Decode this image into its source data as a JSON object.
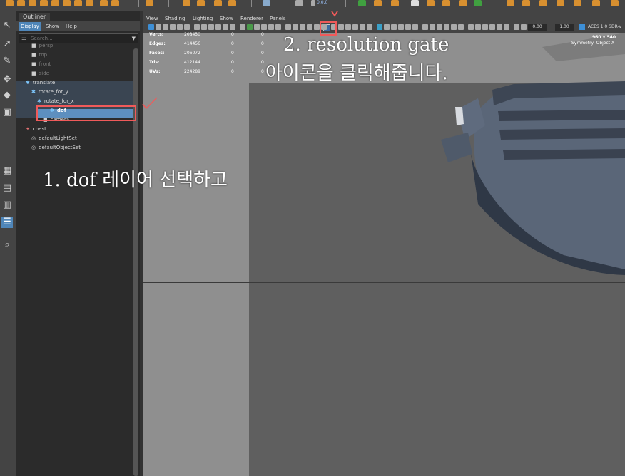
{
  "outliner": {
    "tab_label": "Outliner",
    "menu": [
      "Display",
      "Show",
      "Help"
    ],
    "search_placeholder": "Search...",
    "rows": [
      {
        "label": "persp",
        "icon": "camera-icon",
        "dim": true
      },
      {
        "label": "top",
        "icon": "camera-icon",
        "dim": true
      },
      {
        "label": "front",
        "icon": "camera-icon",
        "dim": true
      },
      {
        "label": "side",
        "icon": "camera-icon",
        "dim": true
      },
      {
        "label": "translate",
        "icon": "transform-icon"
      },
      {
        "label": "rotate_for_y",
        "icon": "transform-icon"
      },
      {
        "label": "rotate_for_x",
        "icon": "transform-icon"
      },
      {
        "label": "dof",
        "icon": "transform-icon",
        "selected": true
      },
      {
        "label": "camera1",
        "icon": "camera-icon"
      },
      {
        "label": "chest",
        "icon": "mesh-icon"
      },
      {
        "label": "defaultLightSet",
        "icon": "set-icon"
      },
      {
        "label": "defaultObjectSet",
        "icon": "set-icon"
      }
    ]
  },
  "viewport": {
    "menu": [
      "View",
      "Shading",
      "Lighting",
      "Show",
      "Renderer",
      "Panels"
    ],
    "field_a": "0.00",
    "field_b": "1.00",
    "colorspace": "ACES 1.0 SDR-v",
    "resolution": "960 x 540",
    "symmetry": "Symmetry: Object X",
    "toolbar_readout": "0,0,0",
    "stats": [
      {
        "label": "Verts:",
        "v1": "208450",
        "v2": "0",
        "v3": "0"
      },
      {
        "label": "Edges:",
        "v1": "414456",
        "v2": "0",
        "v3": "0"
      },
      {
        "label": "Faces:",
        "v1": "206072",
        "v2": "0",
        "v3": "0"
      },
      {
        "label": "Tris:",
        "v1": "412144",
        "v2": "0",
        "v3": "0"
      },
      {
        "label": "UVs:",
        "v1": "224289",
        "v2": "0",
        "v3": "0"
      }
    ]
  },
  "annotations": {
    "step1": "1. dof 레이어 선택하고",
    "step2_line1": "2. resolution gate",
    "step2_line2": "아이콘을 클릭해줍니다."
  },
  "colors": {
    "selection": "#4f86b9",
    "annotation_red": "#f05a5a",
    "gate_bg": "#5f5f5f",
    "outside_gate": "#8f8f8f"
  }
}
